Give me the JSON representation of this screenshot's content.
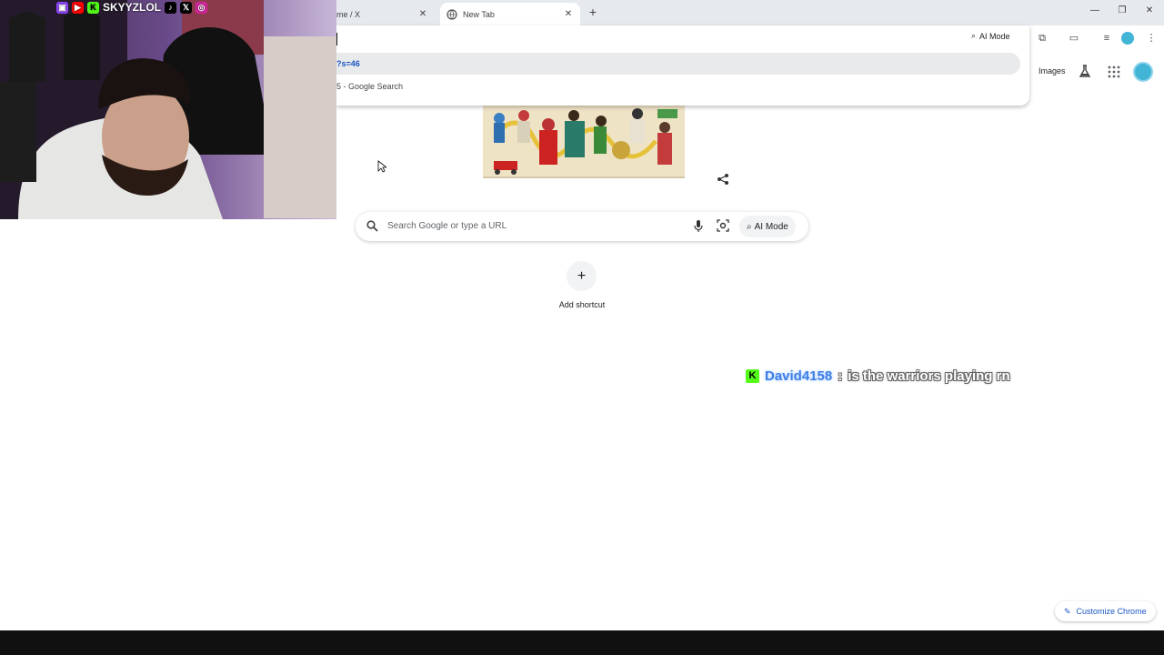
{
  "browser": {
    "tabs": [
      {
        "label": "me / X",
        "active": false
      },
      {
        "label": "New Tab",
        "active": true
      }
    ],
    "window_controls": [
      "minimize",
      "restore",
      "close"
    ]
  },
  "omnibox": {
    "ai_mode_label": "AI Mode",
    "suggestions": [
      {
        "text": "?s=46",
        "type": "url"
      },
      {
        "prefix": "5",
        "text": "- Google Search",
        "type": "search"
      }
    ]
  },
  "ntp": {
    "header": {
      "images_label": "Images"
    },
    "search": {
      "placeholder": "Search Google or type a URL",
      "ai_mode_label": "AI Mode"
    },
    "shortcut": {
      "label": "Add shortcut",
      "symbol": "+"
    },
    "customize_label": "Customize Chrome"
  },
  "stream_overlay": {
    "handle": "SKYYZLOL",
    "chat": {
      "username": "David4158",
      "separator": ":",
      "message": "is the warriors playing rn"
    }
  },
  "colors": {
    "accent_blue": "#1a57c4",
    "kick_green": "#53fc18"
  }
}
